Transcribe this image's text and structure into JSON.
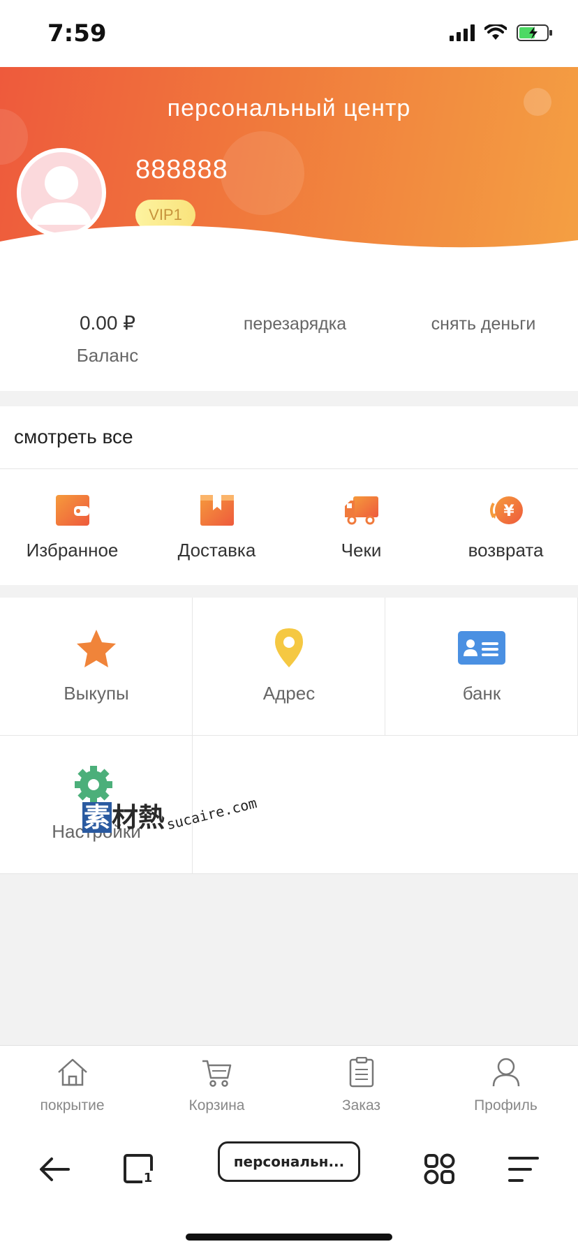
{
  "status": {
    "time": "7:59"
  },
  "header": {
    "title": "персональный центр",
    "username": "888888",
    "vip": "VIP1"
  },
  "balance": {
    "amount": "0.00 ₽",
    "label": "Баланс",
    "recharge": "перезарядка",
    "withdraw": "снять деньги"
  },
  "orders": {
    "title": "смотреть все",
    "items": [
      {
        "label": "Избранное",
        "icon": "wallet-icon"
      },
      {
        "label": "Доставка",
        "icon": "package-icon"
      },
      {
        "label": "Чеки",
        "icon": "truck-icon"
      },
      {
        "label": "возврата",
        "icon": "yuan-refund-icon"
      }
    ]
  },
  "grid": {
    "items": [
      {
        "label": "Выкупы",
        "icon": "star-icon"
      },
      {
        "label": "Адрес",
        "icon": "location-pin-icon"
      },
      {
        "label": "банк",
        "icon": "bank-card-icon"
      },
      {
        "label": "Настройки",
        "icon": "gear-icon"
      }
    ]
  },
  "watermark": {
    "cn": "素材熱",
    "url": "sucaire.com"
  },
  "tabbar": {
    "items": [
      {
        "label": "покрытие",
        "icon": "home-icon"
      },
      {
        "label": "Корзина",
        "icon": "cart-icon"
      },
      {
        "label": "Заказ",
        "icon": "order-list-icon"
      },
      {
        "label": "Профиль",
        "icon": "user-icon"
      }
    ]
  },
  "browser": {
    "address": "персональн..."
  },
  "colors": {
    "header_start": "#ee5a3c",
    "header_end": "#f4a043",
    "accent": "#f07a3c",
    "bank_blue": "#4a90e2",
    "gear_green": "#4caf7a",
    "pin_yellow": "#f5c842"
  }
}
